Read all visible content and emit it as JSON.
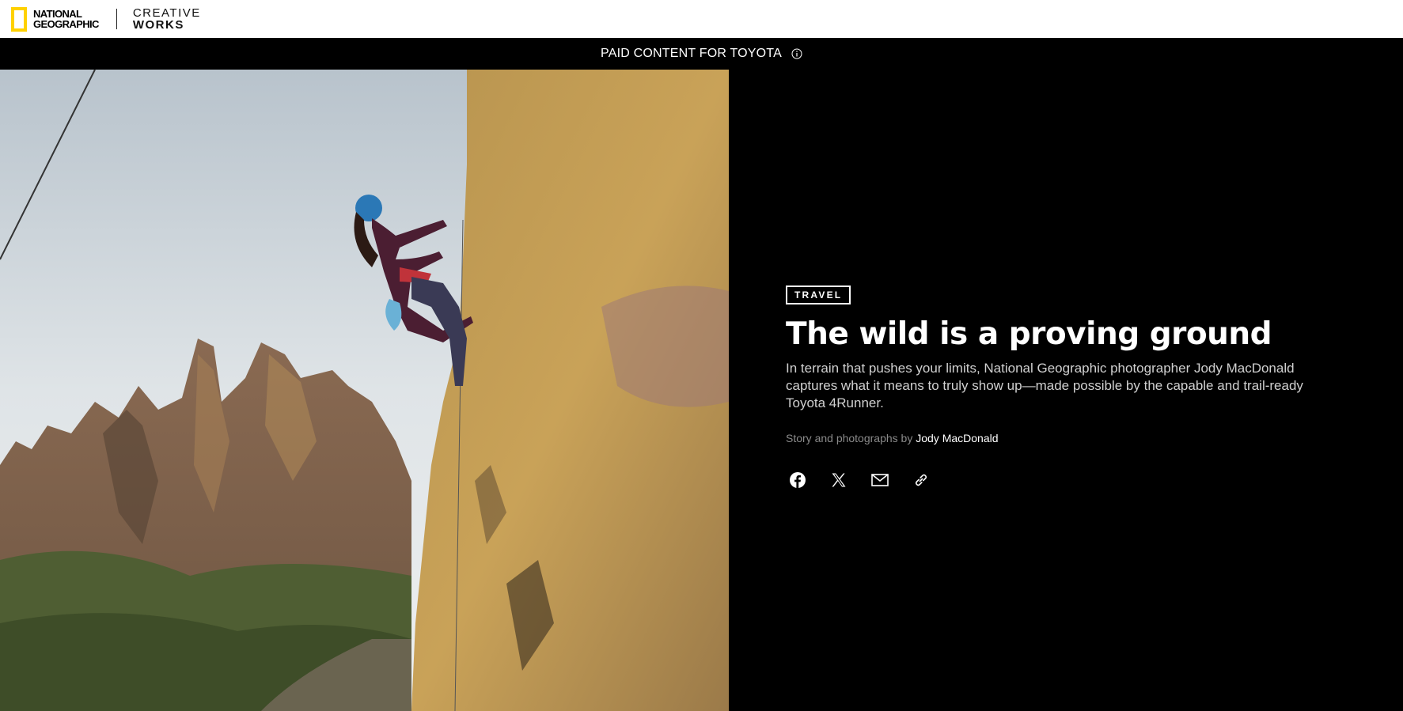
{
  "header": {
    "brand_line1": "NATIONAL",
    "brand_line2": "GEOGRAPHIC",
    "sub_line1": "CREATIVE",
    "sub_line2": "WORKS",
    "logo_accent_color": "#FFD100"
  },
  "paid_bar": {
    "text": "PAID CONTENT FOR TOYOTA",
    "icon": "info-icon"
  },
  "article": {
    "category": "TRAVEL",
    "title": "The wild is a proving ground",
    "dek": "In terrain that pushes your limits, National Geographic photographer Jody MacDonald captures what it means to truly show up—made possible by the capable and trail-ready Toyota 4Runner.",
    "byline_prefix": "Story and photographs by",
    "author": "Jody MacDonald"
  },
  "share": [
    {
      "icon": "facebook-icon"
    },
    {
      "icon": "x-icon"
    },
    {
      "icon": "email-icon"
    },
    {
      "icon": "link-icon"
    }
  ],
  "colors": {
    "panel_bg": "#000000",
    "text_primary": "#ffffff",
    "text_muted": "#8a8a8a"
  }
}
